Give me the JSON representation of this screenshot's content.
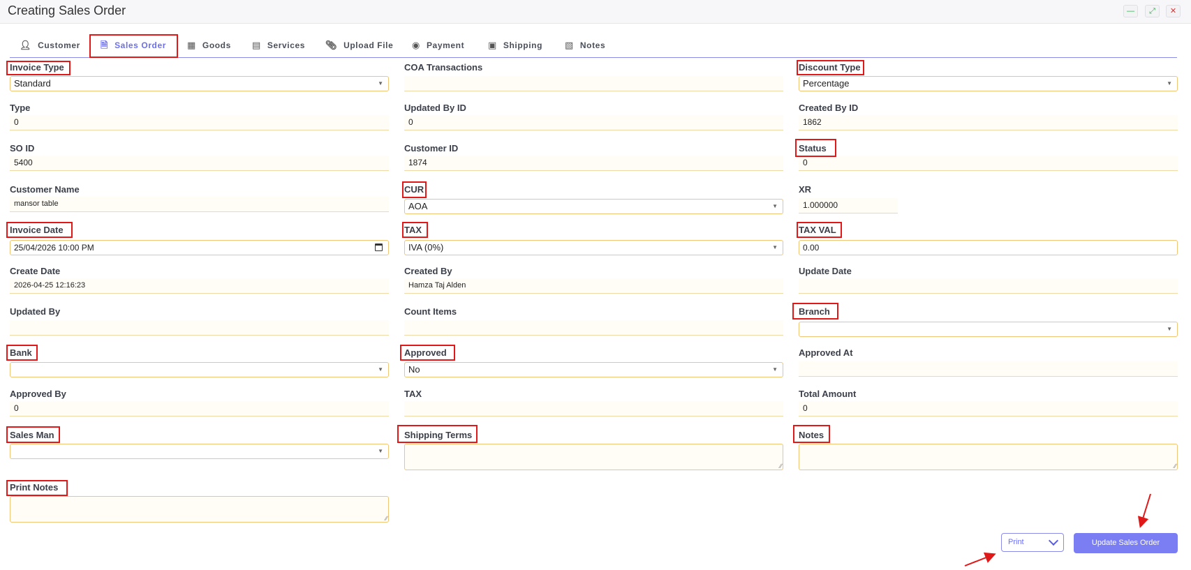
{
  "window": {
    "title": "Creating Sales Order",
    "min_icon": "minimize-icon",
    "max_icon": "maximize-icon",
    "close_icon": "close-icon"
  },
  "tabs": [
    {
      "label": "Customer",
      "icon": "user-icon",
      "active": false
    },
    {
      "label": "Sales Order",
      "icon": "document-icon",
      "active": true
    },
    {
      "label": "Goods",
      "icon": "boxes-icon",
      "active": false
    },
    {
      "label": "Services",
      "icon": "file-text-icon",
      "active": false
    },
    {
      "label": "Upload File",
      "icon": "paperclip-icon",
      "active": false
    },
    {
      "label": "Payment",
      "icon": "money-bag-icon",
      "active": false
    },
    {
      "label": "Shipping",
      "icon": "truck-icon",
      "active": false
    },
    {
      "label": "Notes",
      "icon": "notebook-icon",
      "active": false
    }
  ],
  "form": {
    "invoice_type": {
      "label": "Invoice Type",
      "value": "Standard"
    },
    "coa_transactions": {
      "label": "COA Transactions",
      "value": ""
    },
    "discount_type": {
      "label": "Discount Type",
      "value": "Percentage"
    },
    "type": {
      "label": "Type",
      "value": "0"
    },
    "updated_by_id": {
      "label": "Updated By ID",
      "value": "0"
    },
    "created_by_id": {
      "label": "Created By ID",
      "value": "1862"
    },
    "so_id": {
      "label": "SO ID",
      "value": "5400"
    },
    "customer_id": {
      "label": "Customer ID",
      "value": "1874"
    },
    "status": {
      "label": "Status",
      "value": "0"
    },
    "customer_name": {
      "label": "Customer Name",
      "value": "mansor table"
    },
    "cur": {
      "label": "CUR",
      "value": "AOA"
    },
    "xr": {
      "label": "XR",
      "value": "1.000000"
    },
    "invoice_date": {
      "label": "Invoice Date",
      "value": "25/04/2026 10:00  PM"
    },
    "tax": {
      "label": "TAX",
      "value": "IVA (0%)"
    },
    "tax_val": {
      "label": "TAX VAL",
      "value": "0.00"
    },
    "create_date": {
      "label": "Create Date",
      "value": "2026-04-25 12:16:23"
    },
    "created_by": {
      "label": "Created By",
      "value": "Hamza Taj Alden"
    },
    "update_date": {
      "label": "Update Date",
      "value": ""
    },
    "updated_by": {
      "label": "Updated By",
      "value": ""
    },
    "count_items": {
      "label": "Count Items",
      "value": ""
    },
    "branch": {
      "label": "Branch",
      "value": ""
    },
    "bank": {
      "label": "Bank",
      "value": ""
    },
    "approved": {
      "label": "Approved",
      "value": "No"
    },
    "approved_at": {
      "label": "Approved At",
      "value": ""
    },
    "approved_by": {
      "label": "Approved By",
      "value": "0"
    },
    "tax2": {
      "label": "TAX",
      "value": ""
    },
    "total_amount": {
      "label": "Total Amount",
      "value": "0"
    },
    "sales_man": {
      "label": "Sales Man",
      "value": ""
    },
    "shipping_terms": {
      "label": "Shipping Terms",
      "value": ""
    },
    "notes": {
      "label": "Notes",
      "value": ""
    },
    "print_notes": {
      "label": "Print Notes",
      "value": ""
    }
  },
  "actions": {
    "print_label": "Print",
    "update_label": "Update Sales Order"
  },
  "colors": {
    "accent": "#7b7ef2",
    "highlight_box": "#e01818",
    "field_border": "#f1c576"
  }
}
